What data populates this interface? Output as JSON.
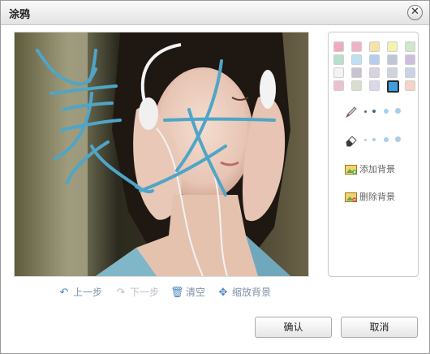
{
  "dialog": {
    "title": "涂鸦",
    "close_glyph": "✕"
  },
  "palette": {
    "colors": [
      "#f1aabd",
      "#f0b2c6",
      "#f7e2a4",
      "#f5f1ae",
      "#d1e7cb",
      "#b8dfcd",
      "#bde0f4",
      "#b6cdee",
      "#c1c6d5",
      "#cdbedd",
      "#f2f2f2",
      "#c9c2d0",
      "#d8d0e3",
      "#cfd3e1",
      "#cbd1e7",
      "#ecc1cf",
      "#d9dfd0",
      "#dcd6ea",
      "#3b9fe0",
      "#f5d3c7"
    ],
    "selected_index": 18
  },
  "tools": {
    "pen_icon": "pen-icon",
    "eraser_icon": "eraser-icon",
    "size_color": "#a8cde8"
  },
  "background": {
    "add_label": "添加背景",
    "remove_label": "删除背景"
  },
  "toolbar": {
    "undo_label": "上一步",
    "redo_label": "下一步",
    "clear_label": "清空",
    "zoom_label": "缩放背景"
  },
  "actions": {
    "ok_label": "确认",
    "cancel_label": "取消"
  }
}
